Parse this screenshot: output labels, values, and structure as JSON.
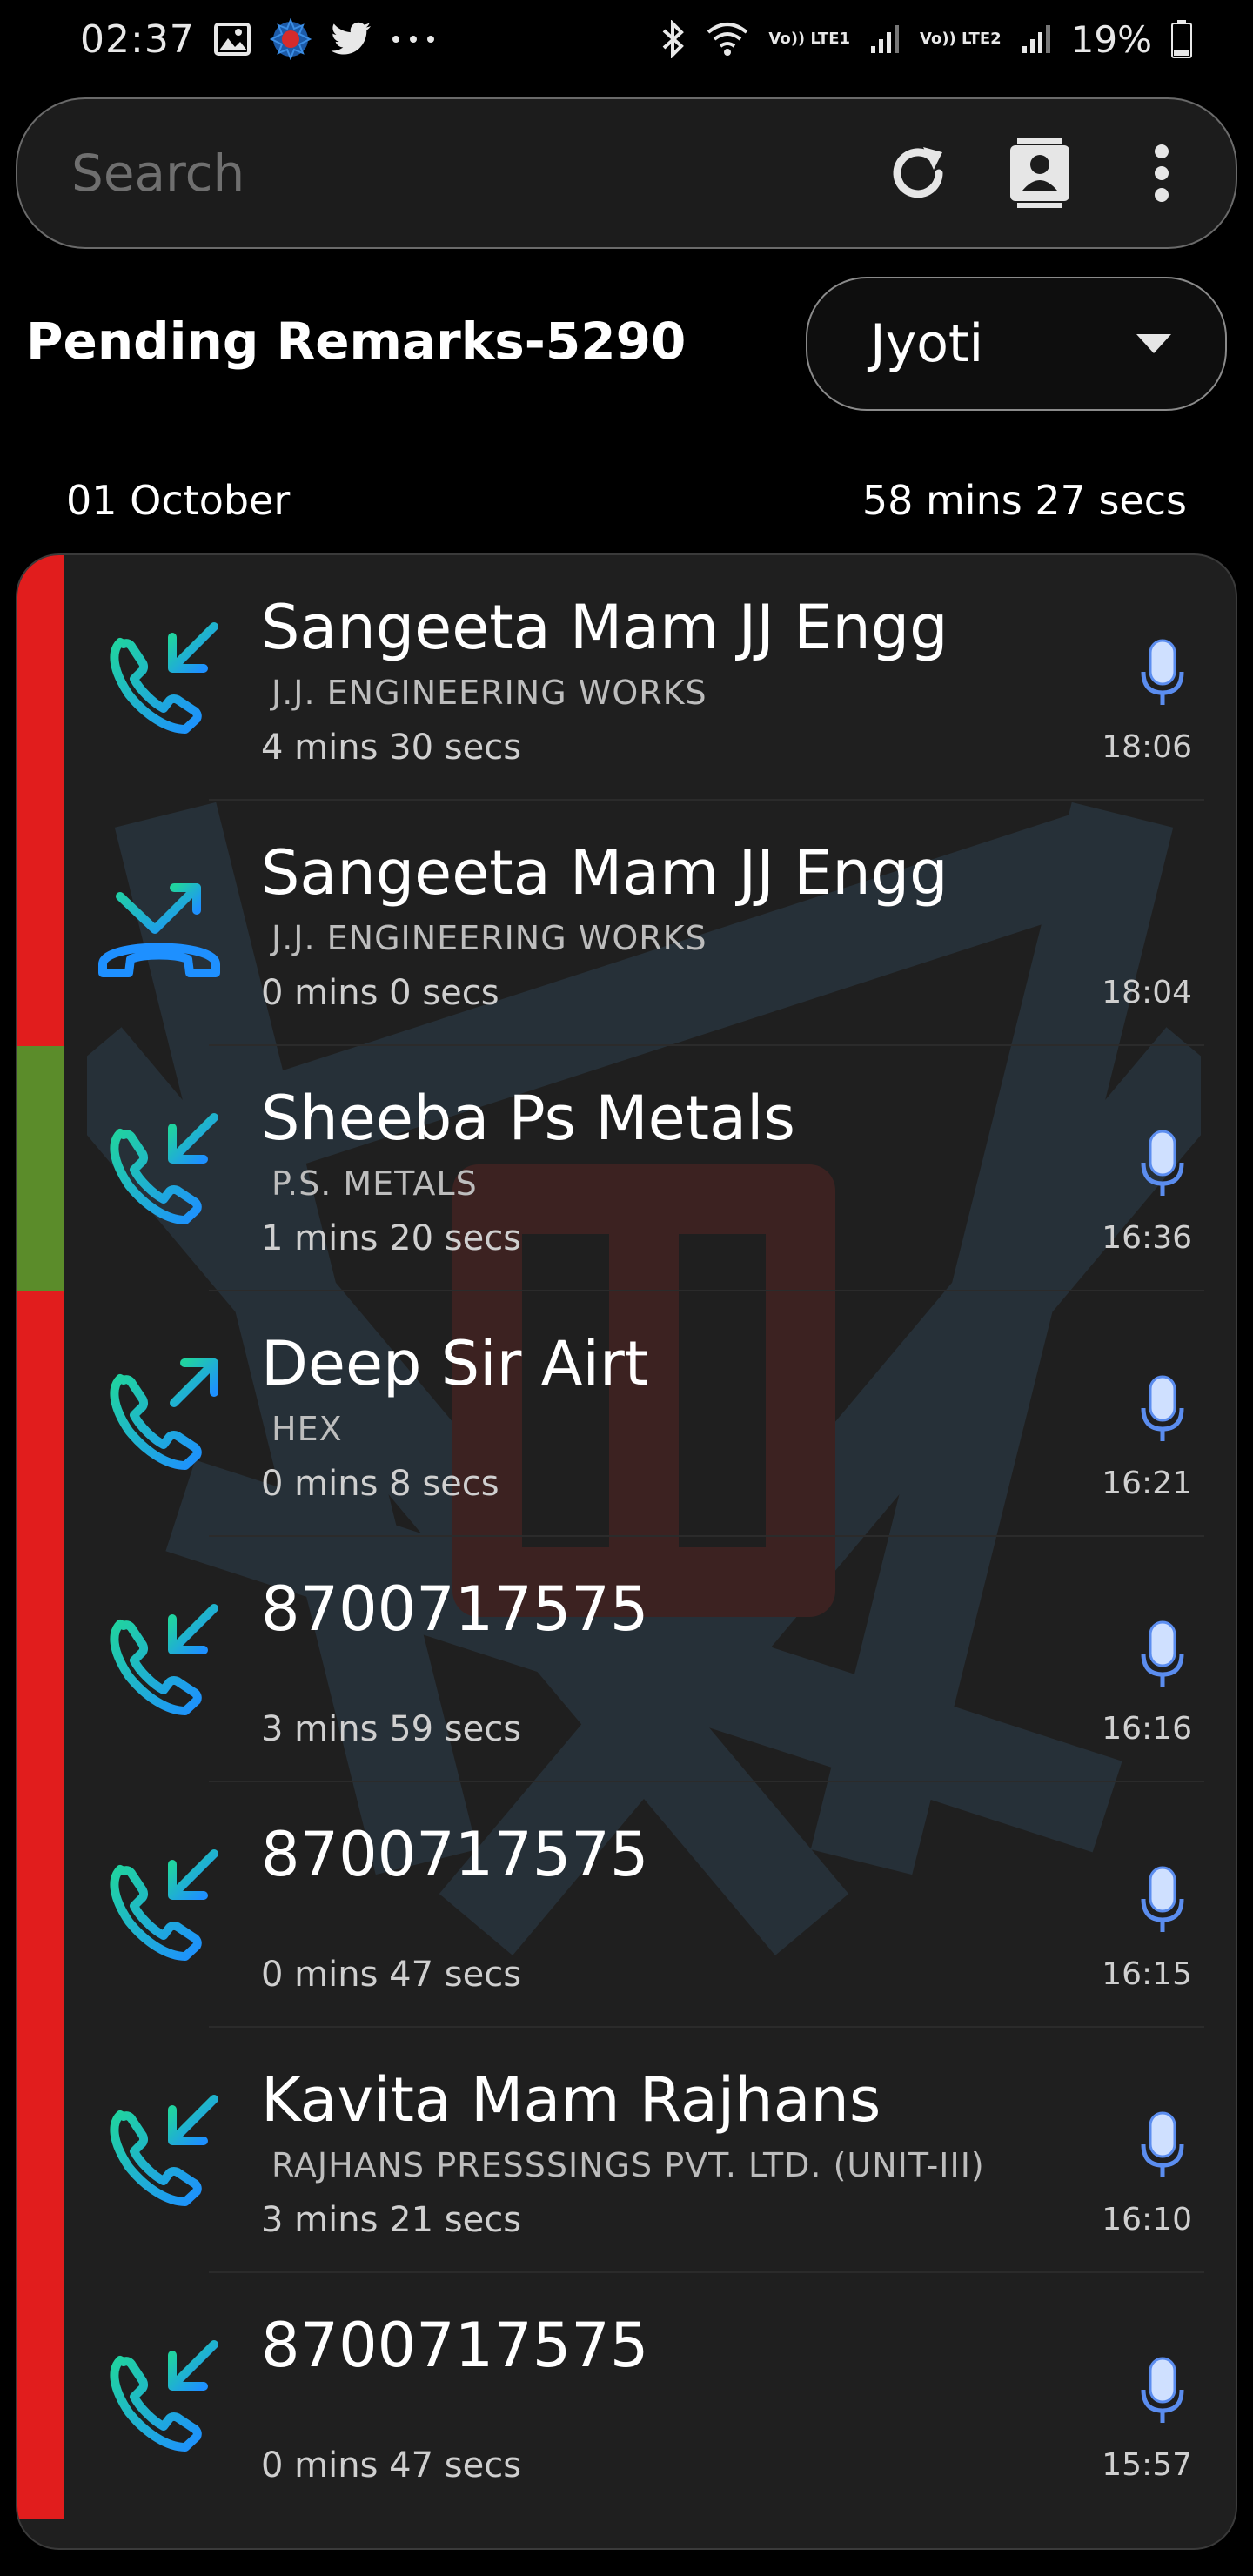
{
  "status_bar": {
    "time": "02:37",
    "left_icons": [
      "image-icon",
      "app-logo-icon",
      "twitter-icon",
      "more-notifications-icon"
    ],
    "sim1_label": "Vo)) LTE1",
    "sim2_label": "Vo)) LTE2",
    "battery_percent": "19%"
  },
  "search": {
    "placeholder": "Search",
    "actions": [
      "refresh-icon",
      "contact-book-icon",
      "kebab-menu-icon"
    ]
  },
  "header": {
    "pending_title": "Pending Remarks-5290",
    "user_selected": "Jyoti"
  },
  "summary": {
    "date": "01 October",
    "total_duration": "58 mins 27 secs"
  },
  "colors": {
    "stripe_red": "#e11d1d",
    "stripe_green": "#5b8c2a",
    "icon_green": "#20d3a0",
    "icon_blue": "#1e90ff",
    "mic_blue": "#5b8def"
  },
  "calls": [
    {
      "name": "Sangeeta Mam JJ Engg",
      "company": "J.J. ENGINEERING WORKS",
      "duration": "4 mins 30 secs",
      "time": "18:06",
      "type": "incoming",
      "has_recording": true,
      "stripe": "red"
    },
    {
      "name": "Sangeeta Mam JJ Engg",
      "company": "J.J. ENGINEERING WORKS",
      "duration": "0 mins 0 secs",
      "time": "18:04",
      "type": "missed-outgoing",
      "has_recording": false,
      "stripe": "red"
    },
    {
      "name": "Sheeba Ps Metals",
      "company": "P.S. METALS",
      "duration": "1 mins 20 secs",
      "time": "16:36",
      "type": "incoming",
      "has_recording": true,
      "stripe": "green"
    },
    {
      "name": "Deep Sir Airt",
      "company": "HEX",
      "duration": "0 mins 8 secs",
      "time": "16:21",
      "type": "outgoing",
      "has_recording": true,
      "stripe": "red"
    },
    {
      "name": "8700717575",
      "company": "",
      "duration": "3 mins 59 secs",
      "time": "16:16",
      "type": "incoming",
      "has_recording": true,
      "stripe": "red"
    },
    {
      "name": "8700717575",
      "company": "",
      "duration": "0 mins 47 secs",
      "time": "16:15",
      "type": "incoming",
      "has_recording": true,
      "stripe": "red"
    },
    {
      "name": "Kavita Mam Rajhans",
      "company": "RAJHANS PRESSSINGS PVT. LTD. (UNIT-III)",
      "duration": "3 mins 21 secs",
      "time": "16:10",
      "type": "incoming",
      "has_recording": true,
      "stripe": "red"
    },
    {
      "name": "8700717575",
      "company": "",
      "duration": "0 mins 47 secs",
      "time": "15:57",
      "type": "incoming",
      "has_recording": true,
      "stripe": "red"
    }
  ]
}
